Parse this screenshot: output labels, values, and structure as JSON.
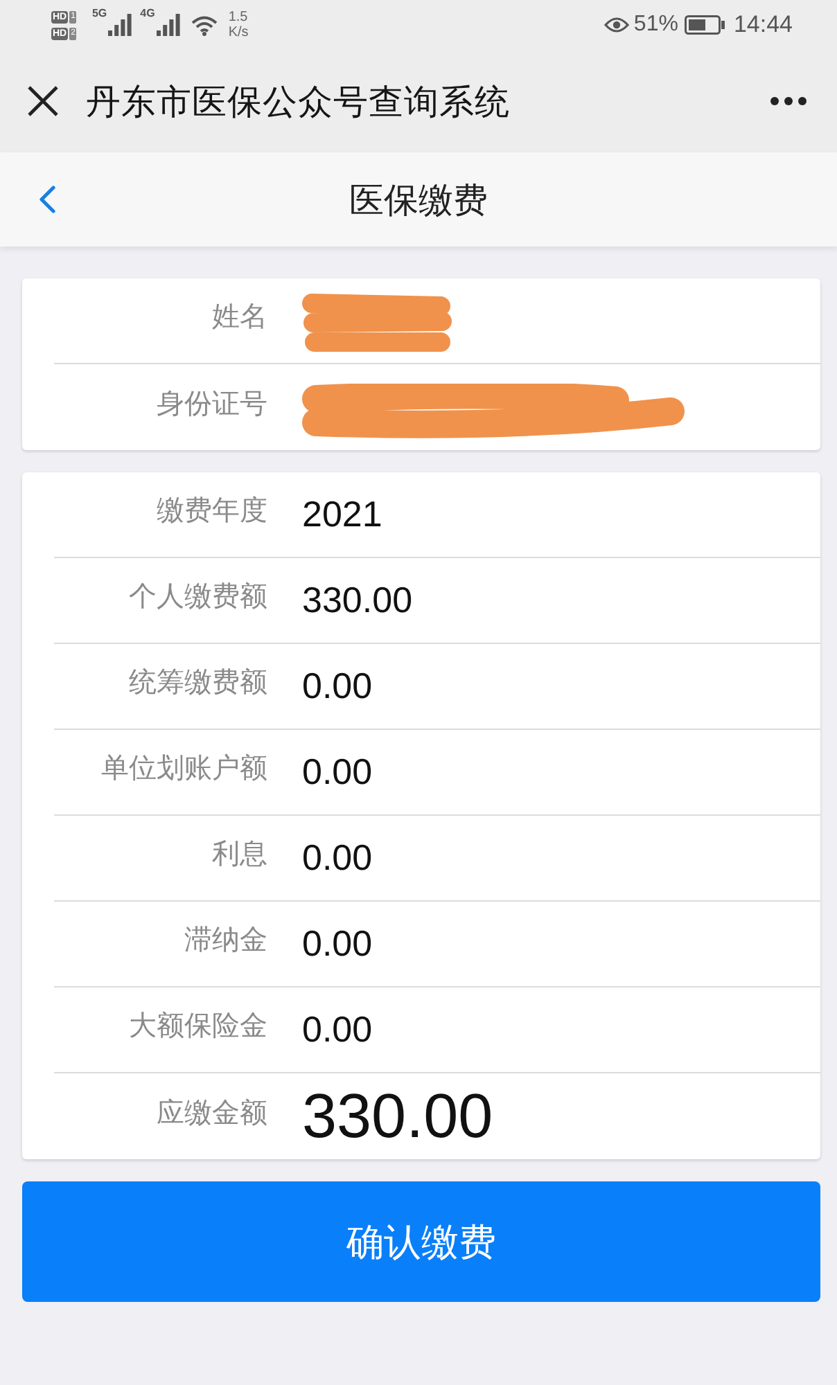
{
  "status_bar": {
    "sims": [
      {
        "badge": "HD",
        "slot": "1"
      },
      {
        "badge": "HD",
        "slot": "2"
      }
    ],
    "networks": [
      {
        "label": "5G"
      },
      {
        "label": "4G"
      }
    ],
    "speed": "1.5",
    "speed_unit": "K/s",
    "battery": "51%",
    "time": "14:44"
  },
  "title_bar": {
    "title": "丹东市医保公众号查询系统"
  },
  "nav_bar": {
    "title": "医保缴费"
  },
  "identity": [
    {
      "label": "姓名",
      "redacted": true
    },
    {
      "label": "身份证号",
      "redacted": true
    }
  ],
  "payment": [
    {
      "label": "缴费年度",
      "value": "2021",
      "kind": "amount"
    },
    {
      "label": "个人缴费额",
      "value": "330.00",
      "kind": "amount"
    },
    {
      "label": "统筹缴费额",
      "value": "0.00",
      "kind": "amount"
    },
    {
      "label": "单位划账户额",
      "value": "0.00",
      "kind": "amount"
    },
    {
      "label": "利息",
      "value": "0.00",
      "kind": "amount"
    },
    {
      "label": "滞纳金",
      "value": "0.00",
      "kind": "amount"
    },
    {
      "label": "大额保险金",
      "value": "0.00",
      "kind": "amount"
    },
    {
      "label": "应缴金额",
      "value": "330.00",
      "kind": "total"
    }
  ],
  "confirm_button": {
    "label": "确认缴费"
  }
}
